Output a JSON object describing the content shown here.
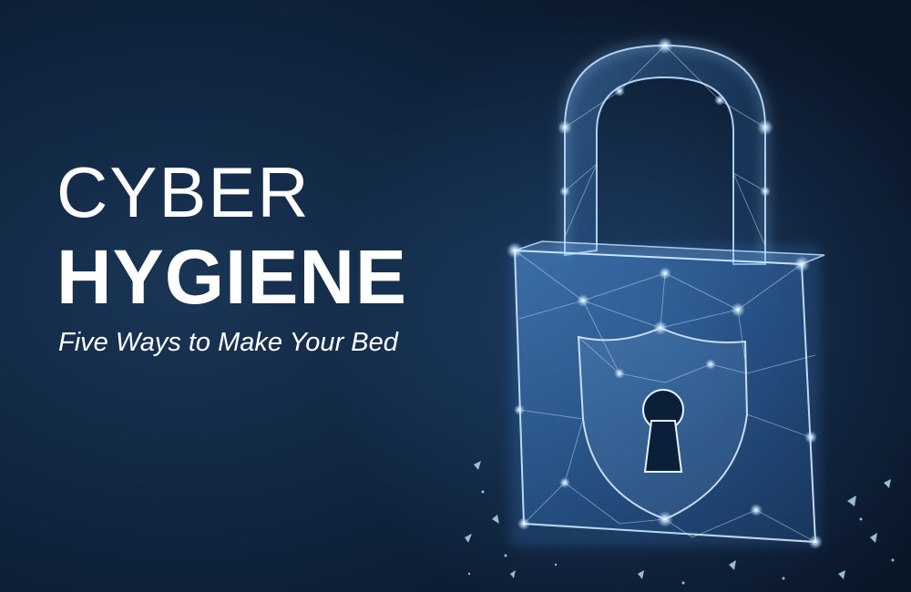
{
  "headline": {
    "line1": "CYBER",
    "line2": "HYGIENE",
    "subtitle": "Five Ways to Make Your Bed"
  },
  "colors": {
    "background": "#0f243d",
    "text": "#ffffff",
    "lock_glow": "#9fd0ff"
  },
  "art": {
    "icon": "padlock-shield-icon"
  }
}
